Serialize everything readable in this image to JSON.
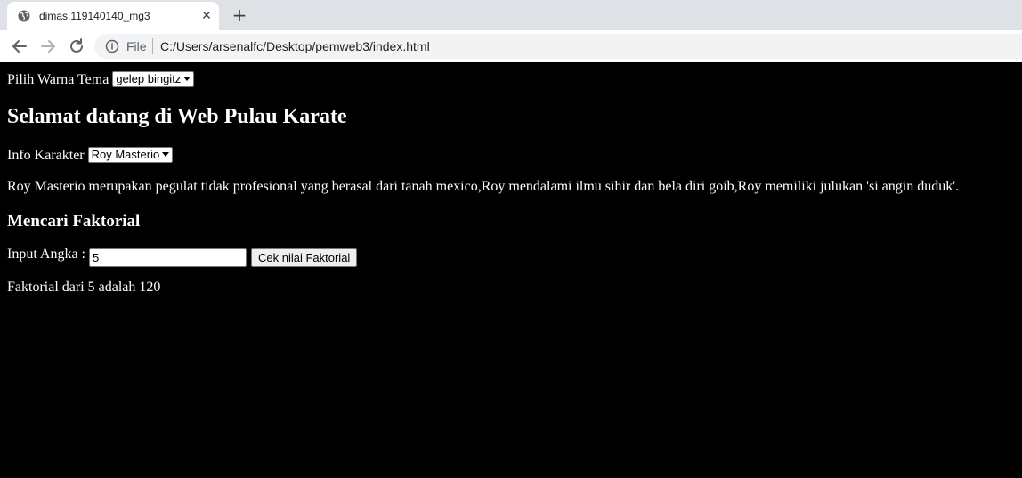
{
  "browser": {
    "tab_title": "dimas.119140140_mg3",
    "close_glyph": "✕",
    "new_tab_glyph": "+",
    "scheme_label": "File",
    "url": "C:/Users/arsenalfc/Desktop/pemweb3/index.html"
  },
  "theme": {
    "label": "Pilih Warna Tema",
    "selected": "gelep bingitz"
  },
  "heading": "Selamat datang di Web Pulau Karate",
  "character": {
    "label": "Info Karakter",
    "selected": "Roy Masterio",
    "description": "Roy Masterio merupakan pegulat tidak profesional yang berasal dari tanah mexico,Roy mendalami ilmu sihir dan bela diri goib,Roy memiliki julukan 'si angin duduk'."
  },
  "factorial": {
    "heading": "Mencari Faktorial",
    "input_label": "Input Angka :",
    "input_value": "5",
    "button_label": "Cek nilai Faktorial",
    "result": "Faktorial dari 5 adalah 120"
  },
  "colors": {
    "page_background": "#000000",
    "page_text": "#ffffff",
    "chrome_background": "#dee1e6"
  },
  "icons": [
    "globe-icon",
    "close-icon",
    "plus-icon",
    "back-arrow-icon",
    "forward-arrow-icon",
    "reload-icon",
    "info-icon",
    "chevron-down-icon"
  ]
}
